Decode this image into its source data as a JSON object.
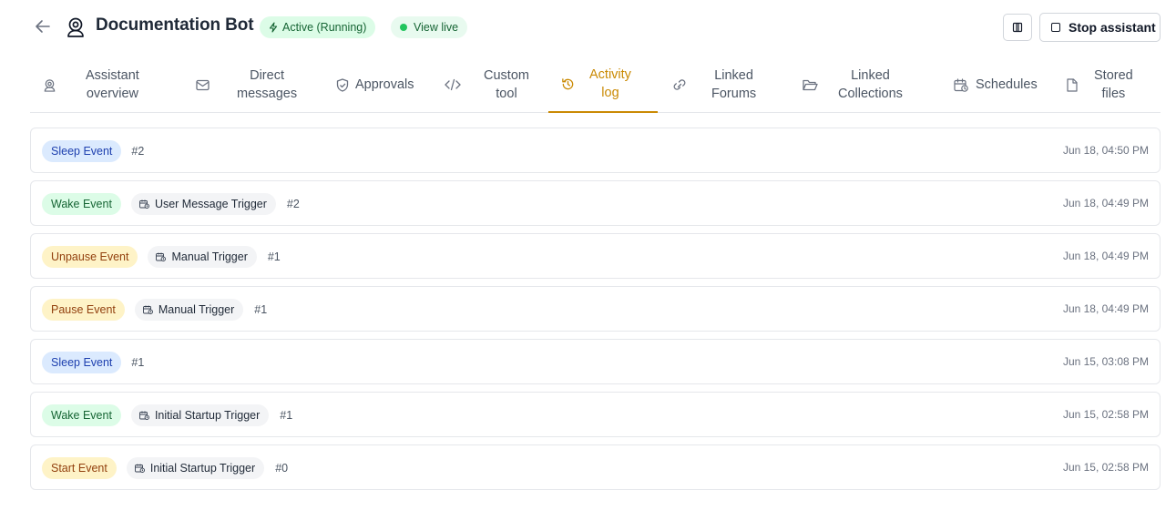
{
  "header": {
    "title": "Documentation Bot",
    "status_label": "Active (Running)",
    "view_live_label": "View live",
    "stop_label": "Stop assistant"
  },
  "tabs": [
    {
      "line1": "Assistant",
      "line2": "overview",
      "icon": "bot-icon"
    },
    {
      "line1": "Direct",
      "line2": "messages",
      "icon": "mail-icon"
    },
    {
      "line1": "Approvals",
      "line2": "",
      "icon": "shield-icon"
    },
    {
      "line1": "Custom",
      "line2": "tool",
      "icon": "code-icon"
    },
    {
      "line1": "Activity",
      "line2": "log",
      "icon": "history-icon",
      "active": true
    },
    {
      "line1": "Linked",
      "line2": "Forums",
      "icon": "link-icon"
    },
    {
      "line1": "Linked",
      "line2": "Collections",
      "icon": "folder-icon"
    },
    {
      "line1": "Schedules",
      "line2": "",
      "icon": "calendar-clock-icon"
    },
    {
      "line1": "Stored",
      "line2": "files",
      "icon": "file-icon"
    }
  ],
  "events": [
    {
      "type": "Sleep Event",
      "color": "blue",
      "trigger": "",
      "seq": "#2",
      "time": "Jun 18, 04:50 PM"
    },
    {
      "type": "Wake Event",
      "color": "green",
      "trigger": "User Message Trigger",
      "seq": "#2",
      "time": "Jun 18, 04:49 PM"
    },
    {
      "type": "Unpause Event",
      "color": "yellow",
      "trigger": "Manual Trigger",
      "seq": "#1",
      "time": "Jun 18, 04:49 PM"
    },
    {
      "type": "Pause Event",
      "color": "yellow",
      "trigger": "Manual Trigger",
      "seq": "#1",
      "time": "Jun 18, 04:49 PM"
    },
    {
      "type": "Sleep Event",
      "color": "blue",
      "trigger": "",
      "seq": "#1",
      "time": "Jun 15, 03:08 PM"
    },
    {
      "type": "Wake Event",
      "color": "green",
      "trigger": "Initial Startup Trigger",
      "seq": "#1",
      "time": "Jun 15, 02:58 PM"
    },
    {
      "type": "Start Event",
      "color": "yellow",
      "trigger": "Initial Startup Trigger",
      "seq": "#0",
      "time": "Jun 15, 02:58 PM"
    }
  ],
  "colors": {
    "accent": "#ca8a04",
    "active_green": "#22c55e"
  }
}
